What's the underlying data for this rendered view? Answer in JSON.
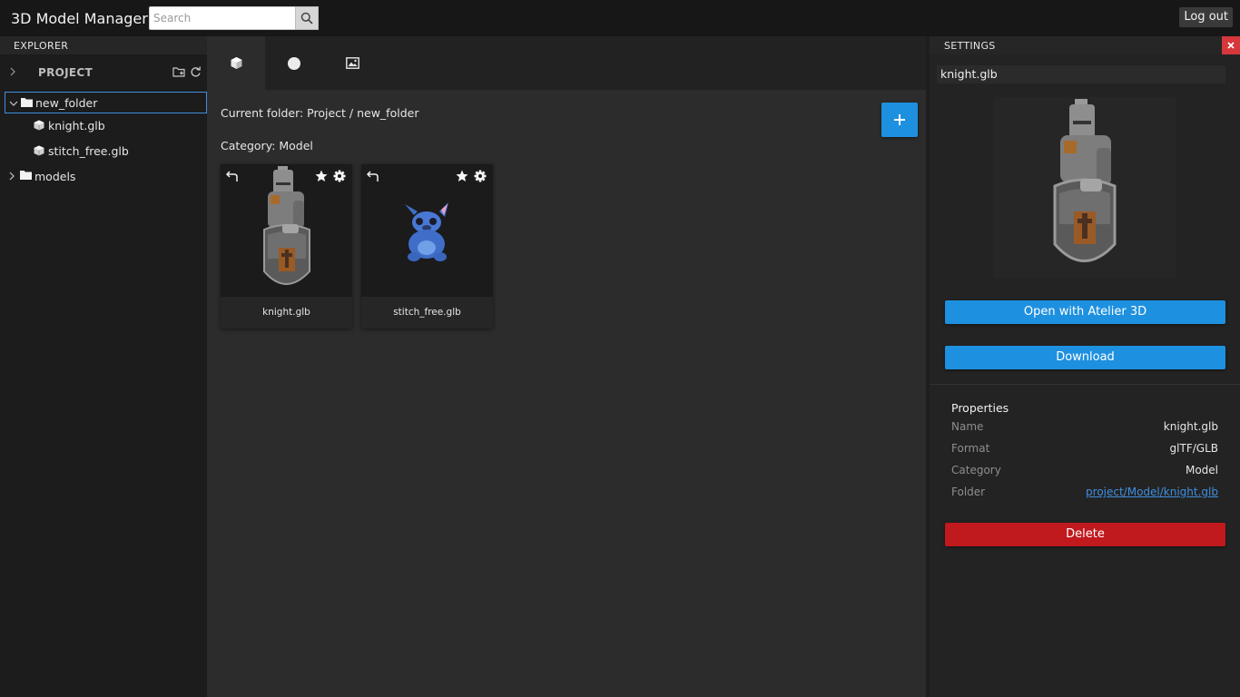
{
  "header": {
    "title": "3D Model Manager",
    "search_placeholder": "Search",
    "search_icon": "search-icon",
    "logout_label": "Log out"
  },
  "explorer": {
    "heading": "EXPLORER",
    "project_label": "PROJECT",
    "project_actions": [
      "new-folder-icon",
      "refresh-icon"
    ],
    "tree": [
      {
        "label": "new_folder",
        "type": "folder",
        "expanded": true,
        "selected": true,
        "children": [
          {
            "label": "knight.glb",
            "type": "model"
          },
          {
            "label": "stitch_free.glb",
            "type": "model"
          }
        ]
      },
      {
        "label": "models",
        "type": "folder",
        "expanded": false
      }
    ]
  },
  "main": {
    "tabs": [
      {
        "icon": "cube-icon",
        "active": true
      },
      {
        "icon": "sphere-icon",
        "active": false
      },
      {
        "icon": "image-icon",
        "active": false
      }
    ],
    "current_folder": "Current folder: Project / new_folder",
    "category": "Category: Model",
    "add_icon": "plus-icon",
    "cards": [
      {
        "name": "knight.glb",
        "icons": [
          "back-arrow-icon",
          "star-icon",
          "gear-icon"
        ]
      },
      {
        "name": "stitch_free.glb",
        "icons": [
          "back-arrow-icon",
          "star-icon",
          "gear-icon"
        ]
      }
    ]
  },
  "settings": {
    "heading": "SETTINGS",
    "close_icon": "close-icon",
    "filename": "knight.glb",
    "open_label": "Open with Atelier 3D",
    "download_label": "Download",
    "properties_title": "Properties",
    "properties": [
      {
        "key": "Name",
        "value": "knight.glb"
      },
      {
        "key": "Format",
        "value": "glTF/GLB"
      },
      {
        "key": "Category",
        "value": "Model"
      },
      {
        "key": "Folder",
        "value": "project/Model/knight.glb"
      }
    ],
    "delete_label": "Delete"
  },
  "colors": {
    "accent": "#1e90e0",
    "danger": "#c0191e",
    "close": "#d6373a",
    "selection": "#3f8fe0"
  }
}
